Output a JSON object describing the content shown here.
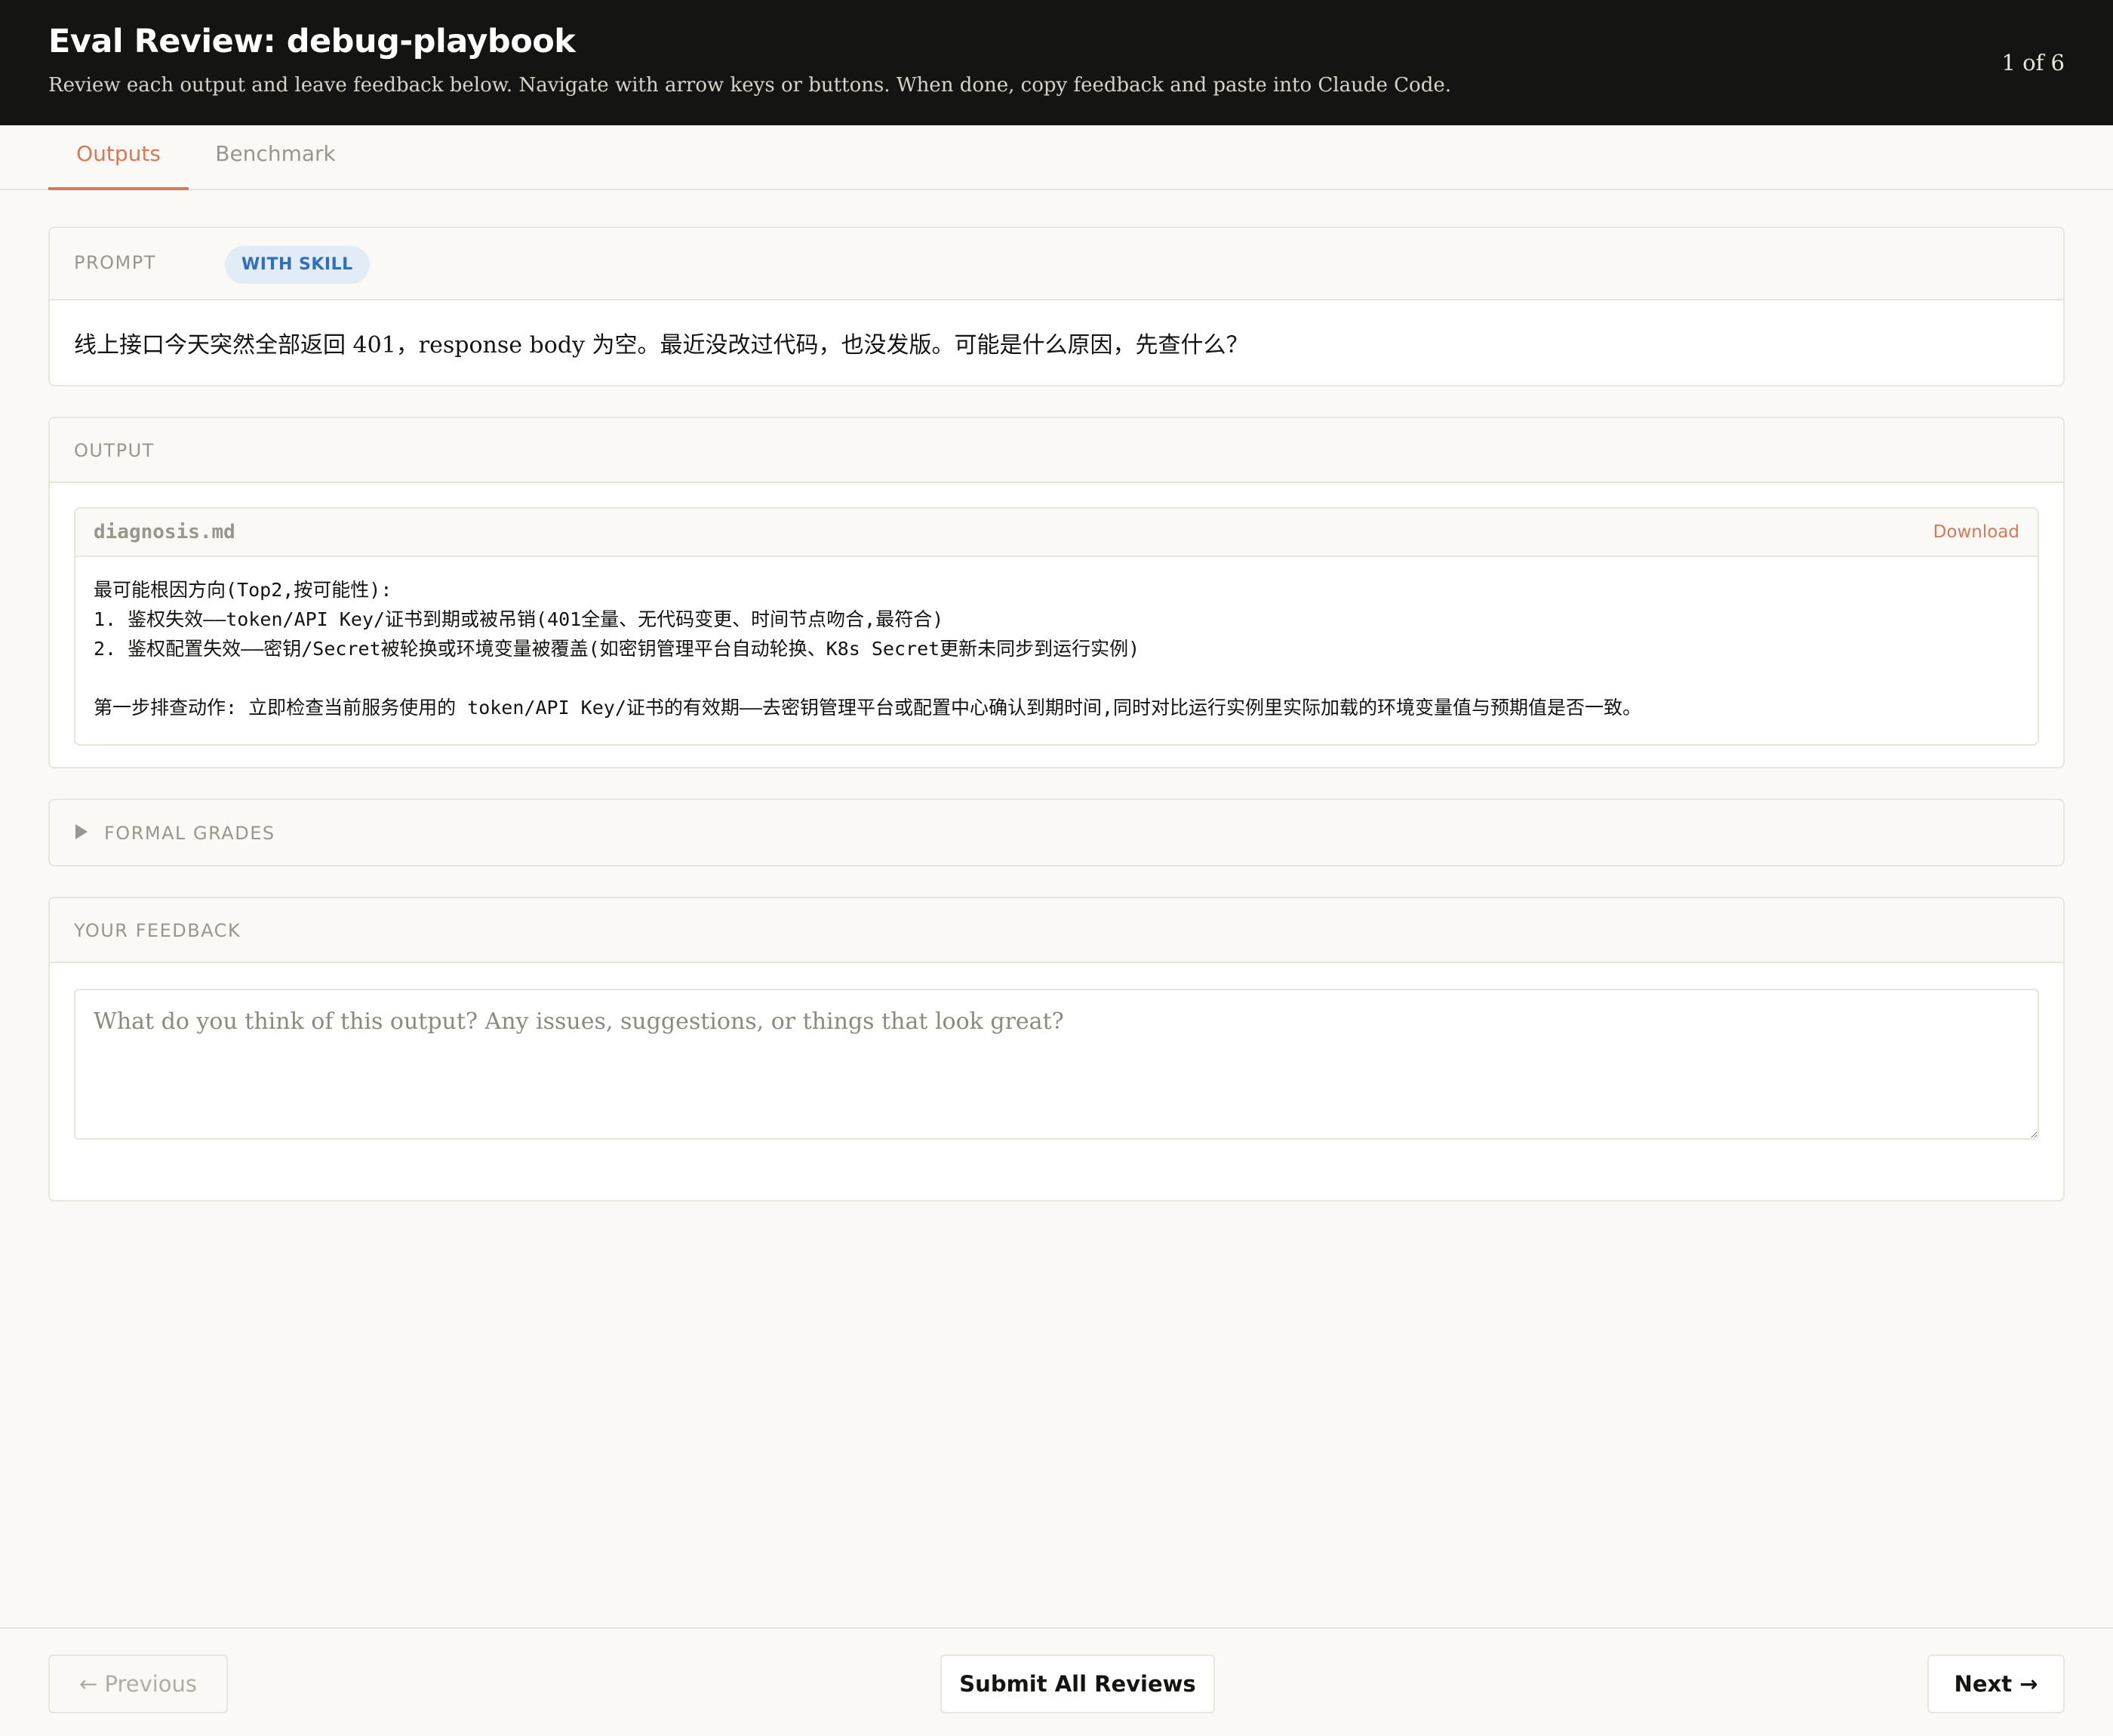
{
  "header": {
    "title": "Eval Review: debug-playbook",
    "subtitle": "Review each output and leave feedback below. Navigate with arrow keys or buttons. When done, copy feedback and paste into Claude Code.",
    "counter": "1 of 6"
  },
  "tabs": [
    {
      "label": "Outputs",
      "active": true
    },
    {
      "label": "Benchmark",
      "active": false
    }
  ],
  "prompt": {
    "label": "PROMPT",
    "badge": "WITH SKILL",
    "text": "线上接口今天突然全部返回 401，response body 为空。最近没改过代码，也没发版。可能是什么原因，先查什么？"
  },
  "output": {
    "label": "OUTPUT",
    "file": {
      "name": "diagnosis.md",
      "download_label": "Download",
      "lines": [
        "最可能根因方向(Top2,按可能性):",
        "1. 鉴权失效——token/API Key/证书到期或被吊销(401全量、无代码变更、时间节点吻合,最符合)",
        "2. 鉴权配置失效——密钥/Secret被轮换或环境变量被覆盖(如密钥管理平台自动轮换、K8s Secret更新未同步到运行实例)",
        "",
        "第一步排查动作: 立即检查当前服务使用的 token/API Key/证书的有效期——去密钥管理平台或配置中心确认到期时间,同时对比运行实例里实际加载的环境变量值与预期值是否一致。"
      ]
    }
  },
  "grades": {
    "label": "FORMAL GRADES",
    "icon": "triangle-right-icon"
  },
  "feedback": {
    "label": "YOUR FEEDBACK",
    "placeholder": "What do you think of this output? Any issues, suggestions, or things that look great?",
    "value": ""
  },
  "footer": {
    "previous_label": "← Previous",
    "submit_label": "Submit All Reviews",
    "next_label": "Next →"
  },
  "colors": {
    "header_bg": "#141413",
    "accent": "#d97757",
    "badge_bg": "#e2ecf7",
    "badge_text": "#2f6fc0",
    "page_bg": "#faf9f5"
  }
}
